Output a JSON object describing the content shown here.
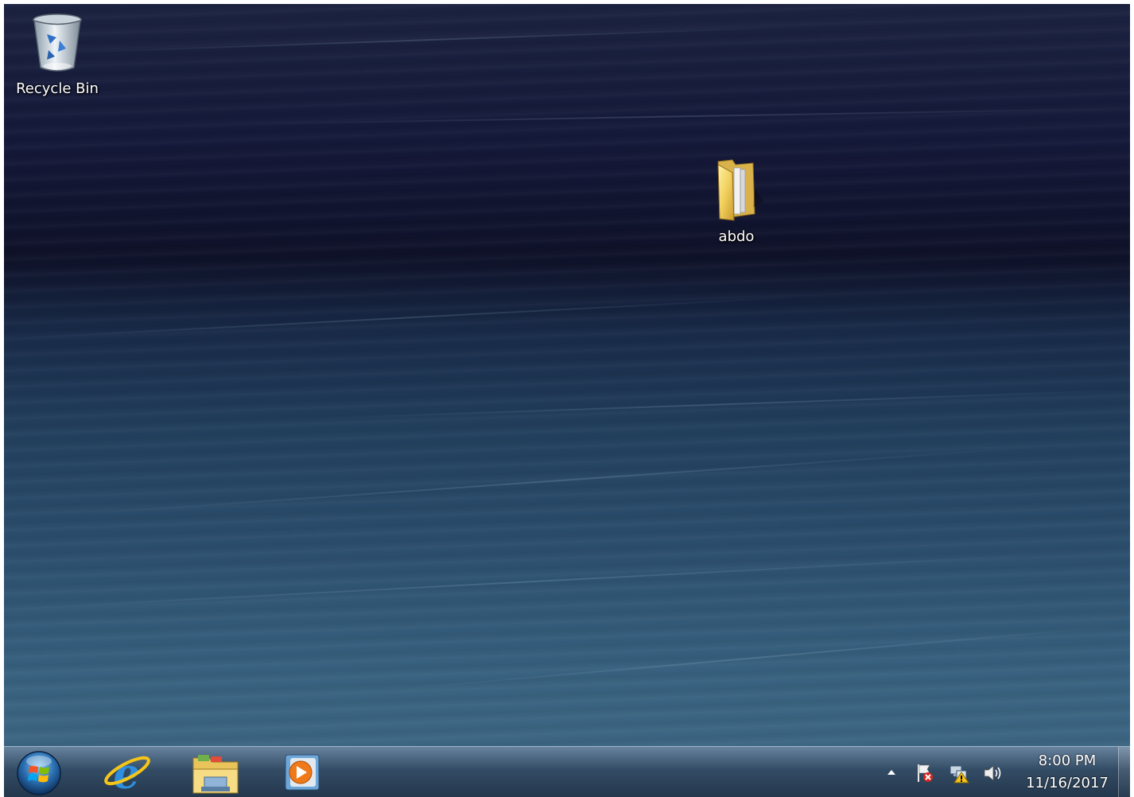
{
  "desktop": {
    "icons": [
      {
        "label": "Recycle Bin",
        "icon": "recycle-bin-icon"
      },
      {
        "label": "abdo",
        "icon": "folder-icon"
      }
    ]
  },
  "taskbar": {
    "start": {
      "icon": "windows-start-orb-icon"
    },
    "pinned": [
      {
        "icon": "internet-explorer-icon"
      },
      {
        "icon": "windows-explorer-icon"
      },
      {
        "icon": "media-player-icon"
      }
    ],
    "tray": {
      "icons": [
        "show-hidden-icons-arrow",
        "action-center-flag-icon",
        "network-warning-icon",
        "volume-icon"
      ],
      "time": "8:00 PM",
      "date": "11/16/2017"
    }
  },
  "colors": {
    "desktop_top": "#15193a",
    "desktop_bottom": "#3c6683",
    "taskbar": "#28425c"
  }
}
